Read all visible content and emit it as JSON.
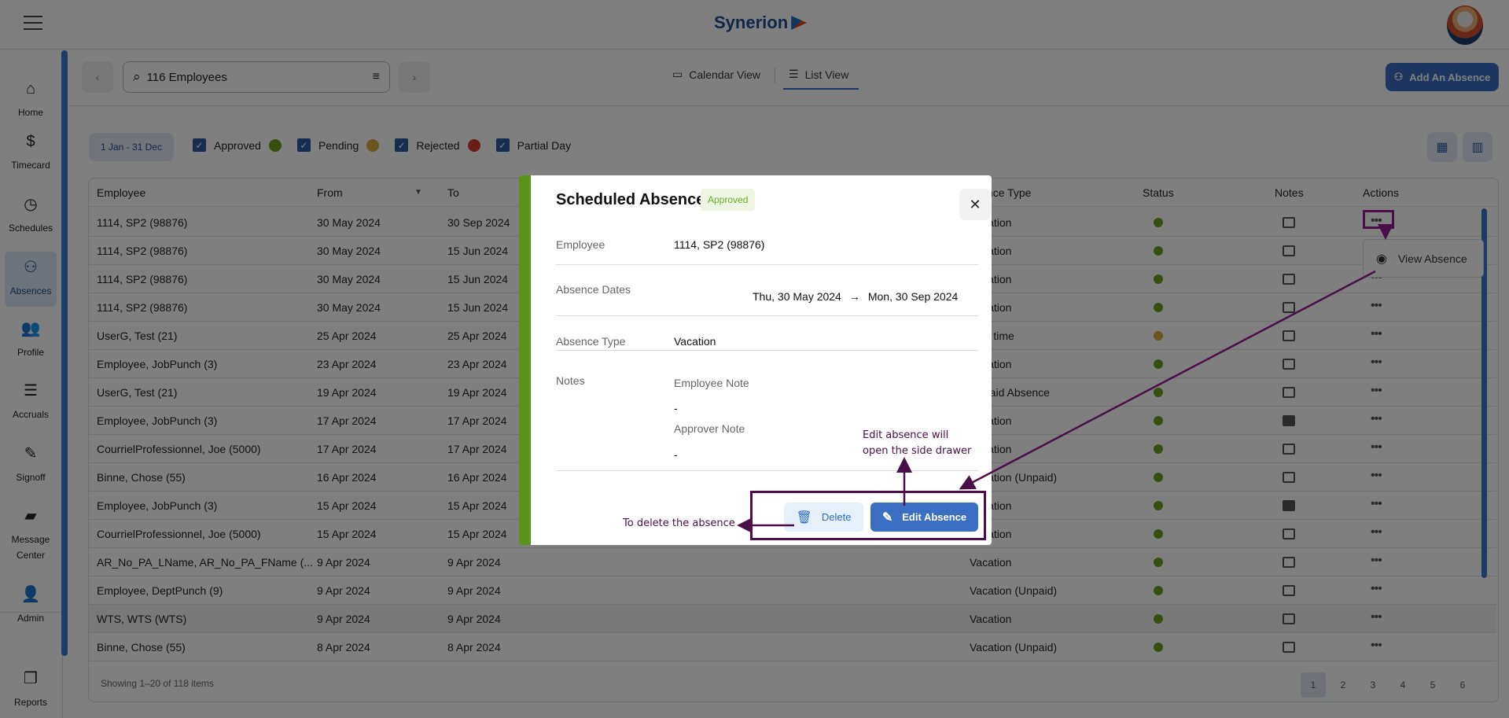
{
  "header": {
    "logo_text": "Synerion",
    "menu_icon": "hamburger-icon"
  },
  "sidebar": {
    "items": [
      {
        "label": "Home",
        "icon": "⌂"
      },
      {
        "label": "Timecard",
        "icon": "$"
      },
      {
        "label": "Schedules",
        "icon": "◷"
      },
      {
        "label": "Absences",
        "icon": "⚇",
        "active": true
      },
      {
        "label": "Profile",
        "icon": "👥"
      },
      {
        "label": "Accruals",
        "icon": "☰"
      },
      {
        "label": "Signoff",
        "icon": "✎"
      },
      {
        "label": "Message Center",
        "icon": "▰"
      },
      {
        "label": "Admin",
        "icon": "👤"
      },
      {
        "label": "Reports",
        "icon": "❐"
      }
    ]
  },
  "toolbar": {
    "search_value": "116 Employees",
    "calendar_view": "Calendar View",
    "list_view": "List View",
    "add_absence": "Add An Absence"
  },
  "filters": {
    "date_range": "1 Jan - 31 Dec",
    "legend": [
      {
        "label": "Approved",
        "color": "#6a9e1c"
      },
      {
        "label": "Pending",
        "color": "#d4ab38"
      },
      {
        "label": "Rejected",
        "color": "#d03a2a"
      },
      {
        "label": "Partial Day"
      }
    ]
  },
  "table": {
    "columns": [
      "Employee",
      "From",
      "To",
      "Absence Type",
      "Status",
      "Notes",
      "Actions"
    ],
    "rows": [
      {
        "employee": "1114, SP2 (98876)",
        "from": "30 May 2024",
        "to": "30 Sep 2024",
        "type": "Vacation",
        "status": "approved",
        "note": false
      },
      {
        "employee": "1114, SP2 (98876)",
        "from": "30 May 2024",
        "to": "15 Jun 2024",
        "type": "Vacation",
        "status": "approved",
        "note": false
      },
      {
        "employee": "1114, SP2 (98876)",
        "from": "30 May 2024",
        "to": "15 Jun 2024",
        "type": "Vacation",
        "status": "approved",
        "note": false
      },
      {
        "employee": "1114, SP2 (98876)",
        "from": "30 May 2024",
        "to": "15 Jun 2024",
        "type": "Vacation",
        "status": "approved",
        "note": false
      },
      {
        "employee": "UserG, Test (21)",
        "from": "25 Apr 2024",
        "to": "25 Apr 2024",
        "type": "Lieu time",
        "status": "pending",
        "note": false
      },
      {
        "employee": "Employee, JobPunch (3)",
        "from": "23 Apr 2024",
        "to": "23 Apr 2024",
        "type": "Vacation",
        "status": "approved",
        "note": false
      },
      {
        "employee": "UserG, Test (21)",
        "from": "19 Apr 2024",
        "to": "19 Apr 2024",
        "type": "Unpaid Absence",
        "status": "approved",
        "note": false
      },
      {
        "employee": "Employee, JobPunch (3)",
        "from": "17 Apr 2024",
        "to": "17 Apr 2024",
        "type": "Vacation",
        "status": "approved",
        "note": true
      },
      {
        "employee": "CourrielProfessionnel, Joe (5000)",
        "from": "17 Apr 2024",
        "to": "17 Apr 2024",
        "type": "Vacation",
        "status": "approved",
        "note": false
      },
      {
        "employee": "Binne, Chose (55)",
        "from": "16 Apr 2024",
        "to": "16 Apr 2024",
        "type": "Vacation (Unpaid)",
        "status": "approved",
        "note": false
      },
      {
        "employee": "Employee, JobPunch (3)",
        "from": "15 Apr 2024",
        "to": "15 Apr 2024",
        "type": "Vacation",
        "status": "approved",
        "note": true
      },
      {
        "employee": "CourrielProfessionnel, Joe (5000)",
        "from": "15 Apr 2024",
        "to": "15 Apr 2024",
        "type": "Vacation",
        "status": "approved",
        "note": false
      },
      {
        "employee": "AR_No_PA_LName, AR_No_PA_FName (...",
        "from": "9 Apr 2024",
        "to": "9 Apr 2024",
        "type": "Vacation",
        "status": "approved",
        "note": false
      },
      {
        "employee": "Employee, DeptPunch (9)",
        "from": "9 Apr 2024",
        "to": "9 Apr 2024",
        "type": "Vacation (Unpaid)",
        "status": "approved",
        "note": false
      },
      {
        "employee": "WTS, WTS (WTS)",
        "from": "9 Apr 2024",
        "to": "9 Apr 2024",
        "type": "Vacation",
        "status": "approved",
        "note": false,
        "hover": true
      },
      {
        "employee": "Binne, Chose (55)",
        "from": "8 Apr 2024",
        "to": "8 Apr 2024",
        "type": "Vacation (Unpaid)",
        "status": "approved",
        "note": false
      }
    ],
    "footer": "Showing 1–20 of 118 items",
    "pages": [
      "1",
      "2",
      "3",
      "4",
      "5",
      "6"
    ],
    "current_page": "1"
  },
  "actions_menu": {
    "view_absence": "View Absence"
  },
  "modal": {
    "title": "Scheduled Absence",
    "badge": "Approved",
    "employee_label": "Employee",
    "employee": "1114, SP2 (98876)",
    "dates_label": "Absence Dates",
    "date_from": "Thu, 30 May 2024",
    "date_to": "Mon, 30 Sep 2024",
    "type_label": "Absence Type",
    "type": "Vacation",
    "notes_label": "Notes",
    "employee_note_label": "Employee Note",
    "employee_note": "-",
    "approver_note_label": "Approver Note",
    "approver_note": "-",
    "delete": "Delete",
    "edit": "Edit Absence"
  },
  "annotations": {
    "delete": "To delete the absence",
    "edit_line1": "Edit absence will",
    "edit_line2": "open the side drawer",
    "color": "#4a0f48"
  },
  "colors": {
    "approved": "#6a9e1c",
    "pending": "#d4ab38",
    "accent": "#3a6fc4"
  }
}
